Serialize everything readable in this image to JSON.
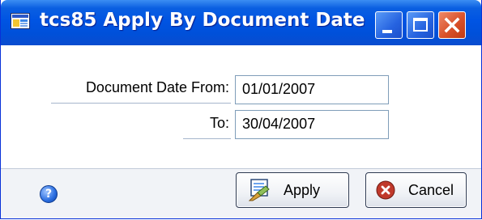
{
  "window": {
    "title": "tcs85 Apply By Document Date",
    "controls": [
      "minimize-icon",
      "maximize-icon",
      "close-icon"
    ],
    "accent_color": "#0054e3",
    "close_color": "#d9512a"
  },
  "form": {
    "from_label": "Document Date From:",
    "from_value": "01/01/2007",
    "to_label": "To:",
    "to_value": "30/04/2007"
  },
  "footer": {
    "help_icon": "help-icon",
    "apply_label": "Apply",
    "apply_icon": "apply-icon",
    "cancel_label": "Cancel",
    "cancel_icon": "cancel-icon"
  }
}
